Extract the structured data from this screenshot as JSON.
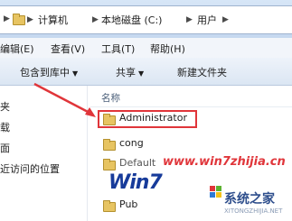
{
  "address": {
    "crumbs": [
      "计算机",
      "本地磁盘 (C:)",
      "用户"
    ]
  },
  "menu": {
    "items": [
      "编辑(E)",
      "查看(V)",
      "工具(T)",
      "帮助(H)"
    ]
  },
  "toolbar": {
    "include_label": "包含到库中",
    "share_label": "共享",
    "new_folder_label": "新建文件夹"
  },
  "nav": {
    "items": [
      "夹",
      "载",
      "面",
      "近访问的位置"
    ]
  },
  "files": {
    "column_header": "名称",
    "rows": [
      "Administrator",
      "cong",
      "Default",
      "Pub"
    ]
  },
  "watermark": {
    "url": "www.win7zhijia.cn",
    "brand": "系统之家",
    "sub": "XITONGZHIJIA.NET"
  },
  "colors": {
    "highlight": "#e0353a",
    "folder": "#e7c462"
  }
}
